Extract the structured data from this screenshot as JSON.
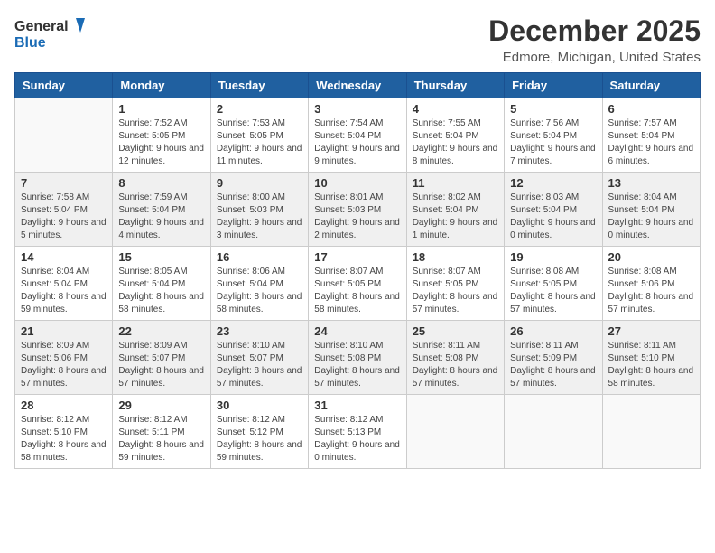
{
  "header": {
    "logo_line1": "General",
    "logo_line2": "Blue",
    "month_title": "December 2025",
    "subtitle": "Edmore, Michigan, United States"
  },
  "weekdays": [
    "Sunday",
    "Monday",
    "Tuesday",
    "Wednesday",
    "Thursday",
    "Friday",
    "Saturday"
  ],
  "weeks": [
    [
      {
        "day": "",
        "sunrise": "",
        "sunset": "",
        "daylight": ""
      },
      {
        "day": "1",
        "sunrise": "Sunrise: 7:52 AM",
        "sunset": "Sunset: 5:05 PM",
        "daylight": "Daylight: 9 hours and 12 minutes."
      },
      {
        "day": "2",
        "sunrise": "Sunrise: 7:53 AM",
        "sunset": "Sunset: 5:05 PM",
        "daylight": "Daylight: 9 hours and 11 minutes."
      },
      {
        "day": "3",
        "sunrise": "Sunrise: 7:54 AM",
        "sunset": "Sunset: 5:04 PM",
        "daylight": "Daylight: 9 hours and 9 minutes."
      },
      {
        "day": "4",
        "sunrise": "Sunrise: 7:55 AM",
        "sunset": "Sunset: 5:04 PM",
        "daylight": "Daylight: 9 hours and 8 minutes."
      },
      {
        "day": "5",
        "sunrise": "Sunrise: 7:56 AM",
        "sunset": "Sunset: 5:04 PM",
        "daylight": "Daylight: 9 hours and 7 minutes."
      },
      {
        "day": "6",
        "sunrise": "Sunrise: 7:57 AM",
        "sunset": "Sunset: 5:04 PM",
        "daylight": "Daylight: 9 hours and 6 minutes."
      }
    ],
    [
      {
        "day": "7",
        "sunrise": "Sunrise: 7:58 AM",
        "sunset": "Sunset: 5:04 PM",
        "daylight": "Daylight: 9 hours and 5 minutes."
      },
      {
        "day": "8",
        "sunrise": "Sunrise: 7:59 AM",
        "sunset": "Sunset: 5:04 PM",
        "daylight": "Daylight: 9 hours and 4 minutes."
      },
      {
        "day": "9",
        "sunrise": "Sunrise: 8:00 AM",
        "sunset": "Sunset: 5:03 PM",
        "daylight": "Daylight: 9 hours and 3 minutes."
      },
      {
        "day": "10",
        "sunrise": "Sunrise: 8:01 AM",
        "sunset": "Sunset: 5:03 PM",
        "daylight": "Daylight: 9 hours and 2 minutes."
      },
      {
        "day": "11",
        "sunrise": "Sunrise: 8:02 AM",
        "sunset": "Sunset: 5:04 PM",
        "daylight": "Daylight: 9 hours and 1 minute."
      },
      {
        "day": "12",
        "sunrise": "Sunrise: 8:03 AM",
        "sunset": "Sunset: 5:04 PM",
        "daylight": "Daylight: 9 hours and 0 minutes."
      },
      {
        "day": "13",
        "sunrise": "Sunrise: 8:04 AM",
        "sunset": "Sunset: 5:04 PM",
        "daylight": "Daylight: 9 hours and 0 minutes."
      }
    ],
    [
      {
        "day": "14",
        "sunrise": "Sunrise: 8:04 AM",
        "sunset": "Sunset: 5:04 PM",
        "daylight": "Daylight: 8 hours and 59 minutes."
      },
      {
        "day": "15",
        "sunrise": "Sunrise: 8:05 AM",
        "sunset": "Sunset: 5:04 PM",
        "daylight": "Daylight: 8 hours and 58 minutes."
      },
      {
        "day": "16",
        "sunrise": "Sunrise: 8:06 AM",
        "sunset": "Sunset: 5:04 PM",
        "daylight": "Daylight: 8 hours and 58 minutes."
      },
      {
        "day": "17",
        "sunrise": "Sunrise: 8:07 AM",
        "sunset": "Sunset: 5:05 PM",
        "daylight": "Daylight: 8 hours and 58 minutes."
      },
      {
        "day": "18",
        "sunrise": "Sunrise: 8:07 AM",
        "sunset": "Sunset: 5:05 PM",
        "daylight": "Daylight: 8 hours and 57 minutes."
      },
      {
        "day": "19",
        "sunrise": "Sunrise: 8:08 AM",
        "sunset": "Sunset: 5:05 PM",
        "daylight": "Daylight: 8 hours and 57 minutes."
      },
      {
        "day": "20",
        "sunrise": "Sunrise: 8:08 AM",
        "sunset": "Sunset: 5:06 PM",
        "daylight": "Daylight: 8 hours and 57 minutes."
      }
    ],
    [
      {
        "day": "21",
        "sunrise": "Sunrise: 8:09 AM",
        "sunset": "Sunset: 5:06 PM",
        "daylight": "Daylight: 8 hours and 57 minutes."
      },
      {
        "day": "22",
        "sunrise": "Sunrise: 8:09 AM",
        "sunset": "Sunset: 5:07 PM",
        "daylight": "Daylight: 8 hours and 57 minutes."
      },
      {
        "day": "23",
        "sunrise": "Sunrise: 8:10 AM",
        "sunset": "Sunset: 5:07 PM",
        "daylight": "Daylight: 8 hours and 57 minutes."
      },
      {
        "day": "24",
        "sunrise": "Sunrise: 8:10 AM",
        "sunset": "Sunset: 5:08 PM",
        "daylight": "Daylight: 8 hours and 57 minutes."
      },
      {
        "day": "25",
        "sunrise": "Sunrise: 8:11 AM",
        "sunset": "Sunset: 5:08 PM",
        "daylight": "Daylight: 8 hours and 57 minutes."
      },
      {
        "day": "26",
        "sunrise": "Sunrise: 8:11 AM",
        "sunset": "Sunset: 5:09 PM",
        "daylight": "Daylight: 8 hours and 57 minutes."
      },
      {
        "day": "27",
        "sunrise": "Sunrise: 8:11 AM",
        "sunset": "Sunset: 5:10 PM",
        "daylight": "Daylight: 8 hours and 58 minutes."
      }
    ],
    [
      {
        "day": "28",
        "sunrise": "Sunrise: 8:12 AM",
        "sunset": "Sunset: 5:10 PM",
        "daylight": "Daylight: 8 hours and 58 minutes."
      },
      {
        "day": "29",
        "sunrise": "Sunrise: 8:12 AM",
        "sunset": "Sunset: 5:11 PM",
        "daylight": "Daylight: 8 hours and 59 minutes."
      },
      {
        "day": "30",
        "sunrise": "Sunrise: 8:12 AM",
        "sunset": "Sunset: 5:12 PM",
        "daylight": "Daylight: 8 hours and 59 minutes."
      },
      {
        "day": "31",
        "sunrise": "Sunrise: 8:12 AM",
        "sunset": "Sunset: 5:13 PM",
        "daylight": "Daylight: 9 hours and 0 minutes."
      },
      {
        "day": "",
        "sunrise": "",
        "sunset": "",
        "daylight": ""
      },
      {
        "day": "",
        "sunrise": "",
        "sunset": "",
        "daylight": ""
      },
      {
        "day": "",
        "sunrise": "",
        "sunset": "",
        "daylight": ""
      }
    ]
  ]
}
